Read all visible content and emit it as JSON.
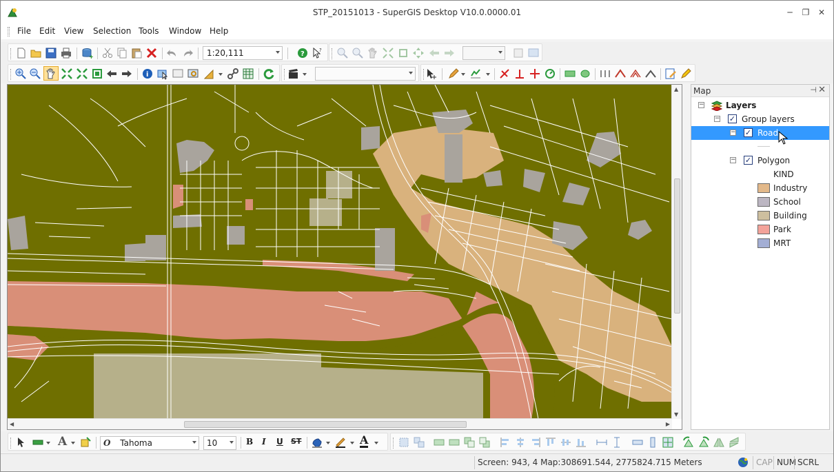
{
  "window": {
    "title": "STP_20151013 - SuperGIS Desktop V10.0.0000.01",
    "minimize": "─",
    "restore": "❐",
    "close": "✕"
  },
  "menu": [
    "File",
    "Edit",
    "View",
    "Selection",
    "Tools",
    "Window",
    "Help"
  ],
  "toolbar1": {
    "scale_value": "1:20,111",
    "icons": [
      "new-icon",
      "open-icon",
      "save-icon",
      "print-icon",
      "add-data-icon",
      "cut-icon",
      "copy-icon",
      "paste-icon",
      "delete-icon",
      "undo-icon",
      "redo-icon",
      "help-icon",
      "whats-this-icon",
      "zoom-in-icon",
      "zoom-out-icon",
      "pan-icon",
      "fixed-zoom-in-icon",
      "fixed-zoom-out-icon",
      "full-extent-icon",
      "back-icon",
      "forward-icon"
    ]
  },
  "toolbar2": {
    "icons": [
      "zoom-in-icon",
      "zoom-out-icon",
      "pan-icon",
      "full-extent-icon",
      "fixed-zoom-icon",
      "zoom-layer-icon",
      "back-icon",
      "forward-icon",
      "identify-icon",
      "select-features-icon",
      "map-tips-icon",
      "find-icon",
      "measure-icon",
      "hyperlink-icon",
      "attribute-table-icon",
      "refresh-icon",
      "clapper-icon",
      "edit-pointer-icon",
      "pencil-icon",
      "sketch-icon",
      "cut-feature-icon",
      "perpendicular-icon",
      "split-icon",
      "rotate-icon",
      "rectangle-icon",
      "ellipse-icon",
      "snap-icon",
      "vertex-icon",
      "reshape-icon",
      "trim-icon",
      "edit-attributes-icon",
      "edit-tool-icon"
    ]
  },
  "map_panel": {
    "title": "Map",
    "pin": "📌",
    "close": "✕",
    "tree": {
      "root": "Layers",
      "group": "Group layers",
      "road": "Road",
      "polygon": "Polygon",
      "kind": "KIND",
      "legend": [
        {
          "label": "Industry",
          "color": "#e3b98a"
        },
        {
          "label": "School",
          "color": "#bcb6c2"
        },
        {
          "label": "Building",
          "color": "#cdbf9f"
        },
        {
          "label": "Park",
          "color": "#f3a39a"
        },
        {
          "label": "MRT",
          "color": "#a3aed4"
        }
      ]
    }
  },
  "map_colors": {
    "background": "#6f6f00",
    "road": "#ffffff",
    "industry": "#d9b27d",
    "school": "#a9a49d",
    "building": "#b6b08a",
    "park": "#d98f78",
    "mrt": "#8f9ac0"
  },
  "bottom_toolbar": {
    "font_name": "Tahoma",
    "font_size": "10",
    "bold": "B",
    "italic": "I",
    "underline": "U",
    "strike": "ST",
    "text_tool": "A",
    "font_color": "A",
    "italic_o": "O"
  },
  "status": {
    "coords": "Screen: 943, 4  Map:308691.544, 2775824.715 Meters",
    "cap": "CAP",
    "num": "NUM",
    "scrl": "SCRL"
  }
}
